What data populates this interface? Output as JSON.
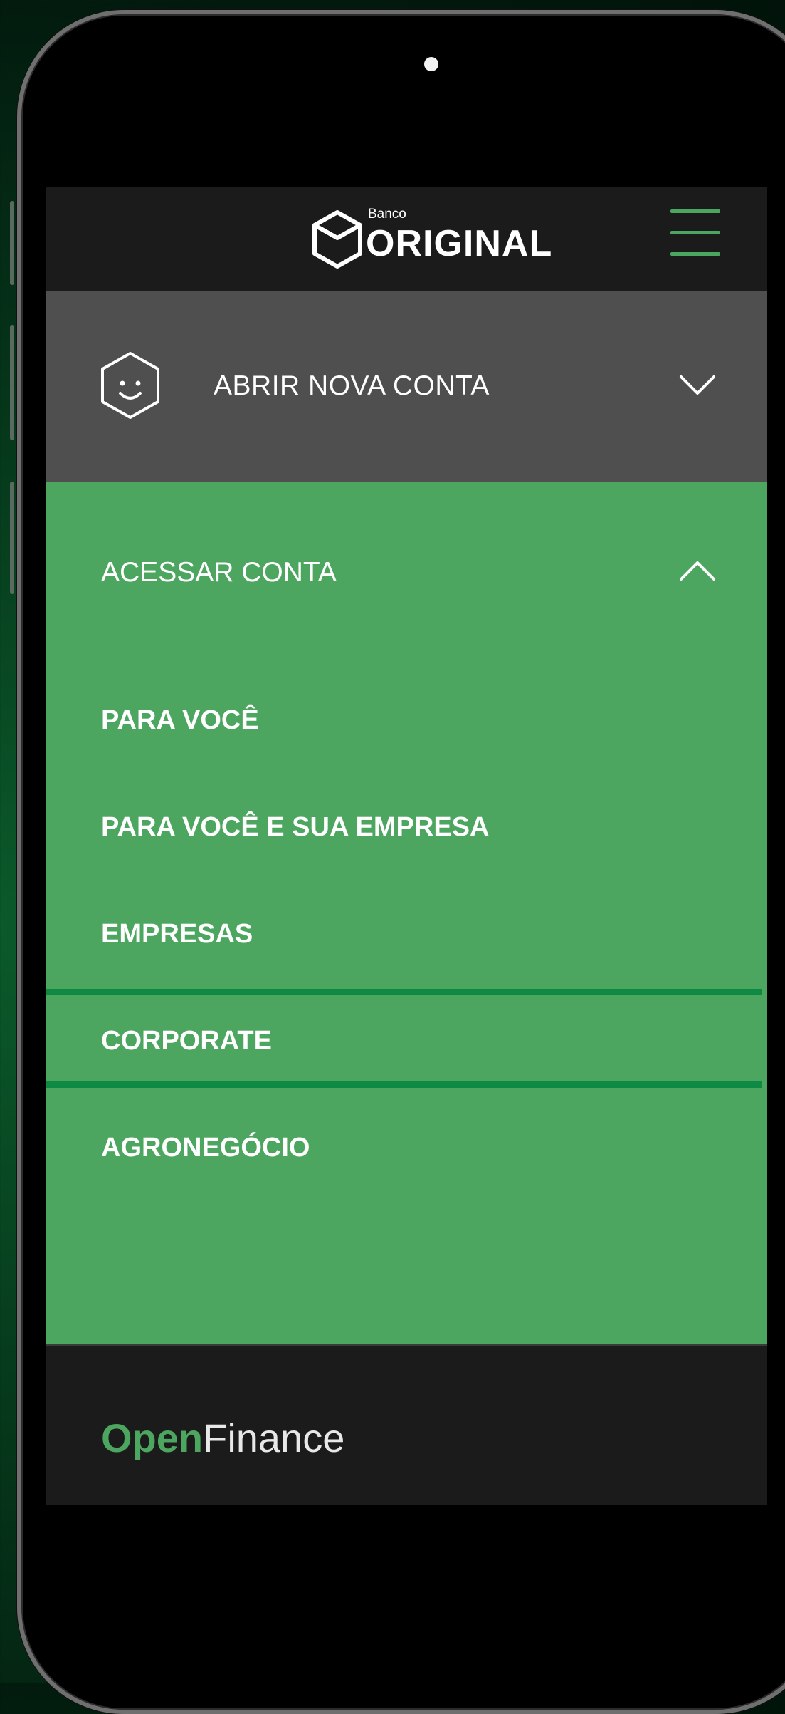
{
  "header": {
    "logo_small": "Banco",
    "logo_big": "ORIGINAL",
    "menu_icon": "hamburger-icon",
    "menu_color": "#4ca65f"
  },
  "open_account": {
    "label": "ABRIR NOVA CONTA",
    "icon": "smiley-hexagon-icon",
    "chevron": "chevron-down-icon"
  },
  "access_account": {
    "label": "ACESSAR CONTA",
    "chevron": "chevron-up-icon",
    "items": [
      {
        "label": "PARA VOCÊ"
      },
      {
        "label": "PARA VOCÊ E SUA EMPRESA"
      },
      {
        "label": "EMPRESAS"
      },
      {
        "label": "CORPORATE"
      },
      {
        "label": "AGRONEGÓCIO"
      }
    ]
  },
  "footer": {
    "open_text": "Open",
    "finance_text": "Finance"
  },
  "colors": {
    "brand_green": "#4ca65f",
    "divider_green": "#0f8a45",
    "header_bg": "#1b1b1b",
    "open_account_bg": "#4f4f4f"
  }
}
